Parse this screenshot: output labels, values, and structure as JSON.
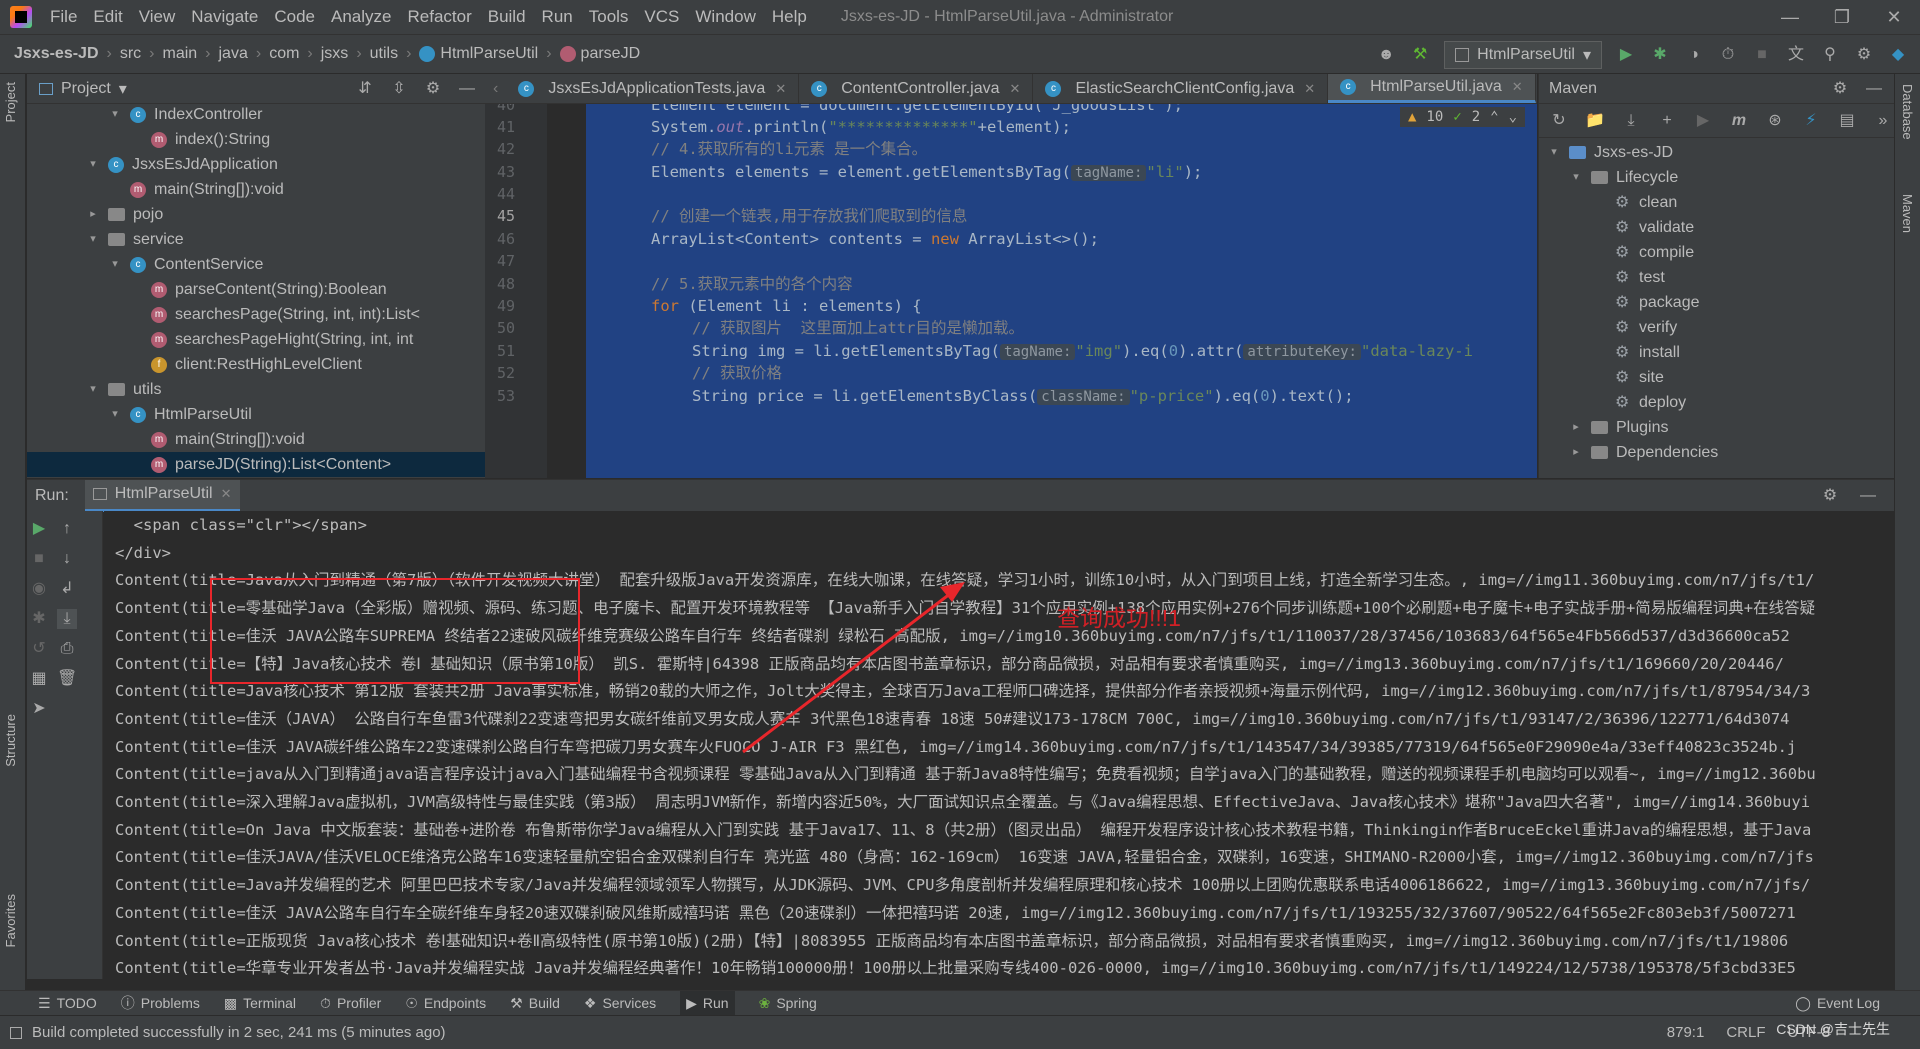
{
  "menubar": {
    "items": [
      "File",
      "Edit",
      "View",
      "Navigate",
      "Code",
      "Analyze",
      "Refactor",
      "Build",
      "Run",
      "Tools",
      "VCS",
      "Window",
      "Help"
    ],
    "title": "Jsxs-es-JD - HtmlParseUtil.java - Administrator"
  },
  "navbar": {
    "crumbs": [
      "Jsxs-es-JD",
      "src",
      "main",
      "java",
      "com",
      "jsxs",
      "utils",
      "HtmlParseUtil",
      "parseJD"
    ],
    "run_config": "HtmlParseUtil"
  },
  "left_strip": {
    "project": "Project",
    "structure": "Structure",
    "favorites": "Favorites"
  },
  "right_strip": {
    "database": "Database",
    "maven": "Maven"
  },
  "project": {
    "title": "Project",
    "nodes": [
      {
        "label": "IndexController",
        "kind": "class",
        "indent": 1,
        "arrow": "▾"
      },
      {
        "label": "index():String",
        "kind": "method",
        "indent": 2,
        "arrow": ""
      },
      {
        "label": "JsxsEsJdApplication",
        "kind": "class",
        "indent": 0,
        "arrow": "▾"
      },
      {
        "label": "main(String[]):void",
        "kind": "method",
        "indent": 1,
        "arrow": ""
      },
      {
        "label": "pojo",
        "kind": "package",
        "indent": 0,
        "arrow": "▸"
      },
      {
        "label": "service",
        "kind": "package",
        "indent": 0,
        "arrow": "▾"
      },
      {
        "label": "ContentService",
        "kind": "class",
        "indent": 1,
        "arrow": "▾"
      },
      {
        "label": "parseContent(String):Boolean",
        "kind": "method",
        "indent": 2,
        "arrow": ""
      },
      {
        "label": "searchesPage(String, int, int):List<",
        "kind": "method",
        "indent": 2,
        "arrow": ""
      },
      {
        "label": "searchesPageHight(String, int, int",
        "kind": "method",
        "indent": 2,
        "arrow": ""
      },
      {
        "label": "client:RestHighLevelClient",
        "kind": "field",
        "indent": 2,
        "arrow": ""
      },
      {
        "label": "utils",
        "kind": "package",
        "indent": 0,
        "arrow": "▾"
      },
      {
        "label": "HtmlParseUtil",
        "kind": "class",
        "indent": 1,
        "arrow": "▾"
      },
      {
        "label": "main(String[]):void",
        "kind": "method",
        "indent": 2,
        "arrow": ""
      },
      {
        "label": "parseJD(String):List<Content>",
        "kind": "method",
        "indent": 2,
        "arrow": "",
        "selected": true
      }
    ]
  },
  "tabs": [
    {
      "label": "JsxsEsJdApplicationTests.java",
      "active": false
    },
    {
      "label": "ContentController.java",
      "active": false
    },
    {
      "label": "ElasticSearchClientConfig.java",
      "active": false
    },
    {
      "label": "HtmlParseUtil.java",
      "active": true
    }
  ],
  "editor": {
    "line_numbers": [
      "40",
      "41",
      "42",
      "43",
      "44",
      "45",
      "46",
      "47",
      "48",
      "49",
      "50",
      "51",
      "52",
      "53"
    ],
    "current_line": "45",
    "warnings": "10",
    "weak_warnings": "2",
    "lines": {
      "l40": "Element element = document.getElementById(\"J_goodsList\");",
      "l41a": "System.",
      "l41b": "out",
      "l41c": ".println(",
      "l41d": "\"**************\"",
      "l41e": "+element);",
      "l42": "// 4.获取所有的li元素 是一个集合。",
      "l43a": "Elements elements = element.getElementsByTag(",
      "l43hint": "tagName:",
      "l43s": "\"li\"",
      "l43e": ");",
      "l45": "// 创建一个链表,用于存放我们爬取到的信息",
      "l46a": "ArrayList<Content> contents = ",
      "l46kw": "new",
      "l46b": " ArrayList<>();",
      "l48": "// 5.获取元素中的各个内容",
      "l49kw": "for",
      "l49b": " (Element li : elements) {",
      "l50": "// 获取图片  这里面加上attr目的是懒加载。",
      "l51a": "String img = li.getElementsByTag(",
      "l51hint": "tagName:",
      "l51s": "\"img\"",
      "l51b": ").eq(",
      "l51n": "0",
      "l51c": ").attr(",
      "l51hint2": "attributeKey:",
      "l51s2": "\"data-lazy-i",
      "l52": "// 获取价格",
      "l53a": "String price = li.getElementsByClass(",
      "l53hint": "className:",
      "l53s": "\"p-price\"",
      "l53b": ").eq(",
      "l53n": "0",
      "l53c": ").text();"
    }
  },
  "maven": {
    "title": "Maven",
    "root": "Jsxs-es-JD",
    "lifecycle_label": "Lifecycle",
    "lifecycle": [
      "clean",
      "validate",
      "compile",
      "test",
      "package",
      "verify",
      "install",
      "site",
      "deploy"
    ],
    "plugins": "Plugins",
    "dependencies": "Dependencies"
  },
  "run": {
    "label": "Run:",
    "tab": "HtmlParseUtil",
    "console": [
      "  <span class=\"clr\"></span>",
      "</div>",
      "Content(title=Java从入门到精通（第7版）（软件开发视频大讲堂） 配套升级版Java开发资源库，在线大咖课，在线答疑，学习1小时，训练10小时，从入门到项目上线，打造全新学习生态。, img=//img11.360buyimg.com/n7/jfs/t1/",
      "Content(title=零基础学Java（全彩版）赠视频、源码、练习题、电子魔卡、配置开发环境教程等 【Java新手入门自学教程】31个应用实例+138个应用实例+276个同步训练题+100个必刷题+电子魔卡+电子实战手册+简易版编程词典+在线答疑",
      "Content(title=佳沃 JAVA公路车SUPREMA 终结者22速破风碳纤维竞赛级公路车自行车 终结者碟刹 绿松石 高配版, img=//img10.360buyimg.com/n7/jfs/t1/110037/28/37456/103683/64f565e4Fb566d537/d3d36600ca52",
      "Content(title=【特】Java核心技术 卷Ⅰ 基础知识（原书第10版） 凯S. 霍斯特|64398 正版商品均有本店图书盖章标识，部分商品微损，对品相有要求者慎重购买, img=//img13.360buyimg.com/n7/jfs/t1/169660/20/20446/",
      "Content(title=Java核心技术 第12版 套装共2册 Java事实标准，畅销20载的大师之作，Jolt大奖得主，全球百万Java工程师口碑选择，提供部分作者亲授视频+海量示例代码, img=//img12.360buyimg.com/n7/jfs/t1/87954/34/3",
      "Content(title=佳沃（JAVA） 公路自行车鱼雷3代碟刹22变速弯把男女碳纤维前叉男女成人赛车 3代黑色18速青春 18速 50#建议173-178CM 700C, img=//img10.360buyimg.com/n7/jfs/t1/93147/2/36396/122771/64d3074",
      "Content(title=佳沃 JAVA碳纤维公路车22变速碟刹公路自行车弯把碳刀男女赛车火FUOCO J-AIR F3 黑红色, img=//img14.360buyimg.com/n7/jfs/t1/143547/34/39385/77319/64f565e0F29090e4a/33eff40823c3524b.j",
      "Content(title=java从入门到精通java语言程序设计java入门基础编程书含视频课程 零基础Java从入门到精通 基于新Java8特性编写；免费看视频；自学java入门的基础教程，赠送的视频课程手机电脑均可以观看~, img=//img12.360bu",
      "Content(title=深入理解Java虚拟机，JVM高级特性与最佳实践（第3版） 周志明JVM新作，新增内容近50%，大厂面试知识点全覆盖。与《Java编程思想、EffectiveJava、Java核心技术》堪称\"Java四大名著\", img=//img14.360buyi",
      "Content(title=On Java 中文版套装：基础卷+进阶卷 布鲁斯带你学Java编程从入门到实践 基于Java17、11、8（共2册）（图灵出品） 编程开发程序设计核心技术教程书籍，Thinkingin作者BruceEckel重讲Java的编程思想，基于Java",
      "Content(title=佳沃JAVA/佳沃VELOCE维洛克公路车16变速轻量航空铝合金双碟刹自行车 亮光蓝 480（身高：162-169cm） 16变速 JAVA,轻量铝合金，双碟刹，16变速，SHIMANO-R2000小套, img=//img12.360buyimg.com/n7/jfs",
      "Content(title=Java并发编程的艺术 阿里巴巴技术专家/Java并发编程领域领军人物撰写，从JDK源码、JVM、CPU多角度剖析并发编程原理和核心技术 100册以上团购优惠联系电话4006186622, img=//img13.360buyimg.com/n7/jfs/",
      "Content(title=佳沃 JAVA公路车自行车全碳纤维车身轻20速双碟刹破风维斯威禧玛诺 黑色（20速碟刹）一体把禧玛诺 20速, img=//img12.360buyimg.com/n7/jfs/t1/193255/32/37607/90522/64f565e2Fc803eb3f/5007271",
      "Content(title=正版现货 Java核心技术 卷Ⅰ基础知识+卷Ⅱ高级特性(原书第10版)(2册)【特】|8083955 正版商品均有本店图书盖章标识，部分商品微损，对品相有要求者慎重购买, img=//img12.360buyimg.com/n7/jfs/t1/19806",
      "Content(title=华章专业开发者丛书·Java并发编程实战 Java并发编程经典著作！10年畅销100000册！100册以上批量采购专线400-026-0000, img=//img10.360buyimg.com/n7/jfs/t1/149224/12/5738/195378/5f3cbd33E5"
    ]
  },
  "annotation": {
    "text": "查询成功!!!1"
  },
  "bottombar": {
    "items": [
      "TODO",
      "Problems",
      "Terminal",
      "Profiler",
      "Endpoints",
      "Build",
      "Services",
      "Run",
      "Spring"
    ],
    "event_log": "Event Log"
  },
  "statusbar": {
    "message": "Build completed successfully in 2 sec, 241 ms (5 minutes ago)",
    "position": "879:1",
    "line_sep": "CRLF",
    "encoding": "UTF-8",
    "watermark": "CSDN @吉士先生"
  },
  "colors": {
    "accent": "#4a88c7",
    "selection": "#214283",
    "annotation_red": "#e8262b"
  }
}
